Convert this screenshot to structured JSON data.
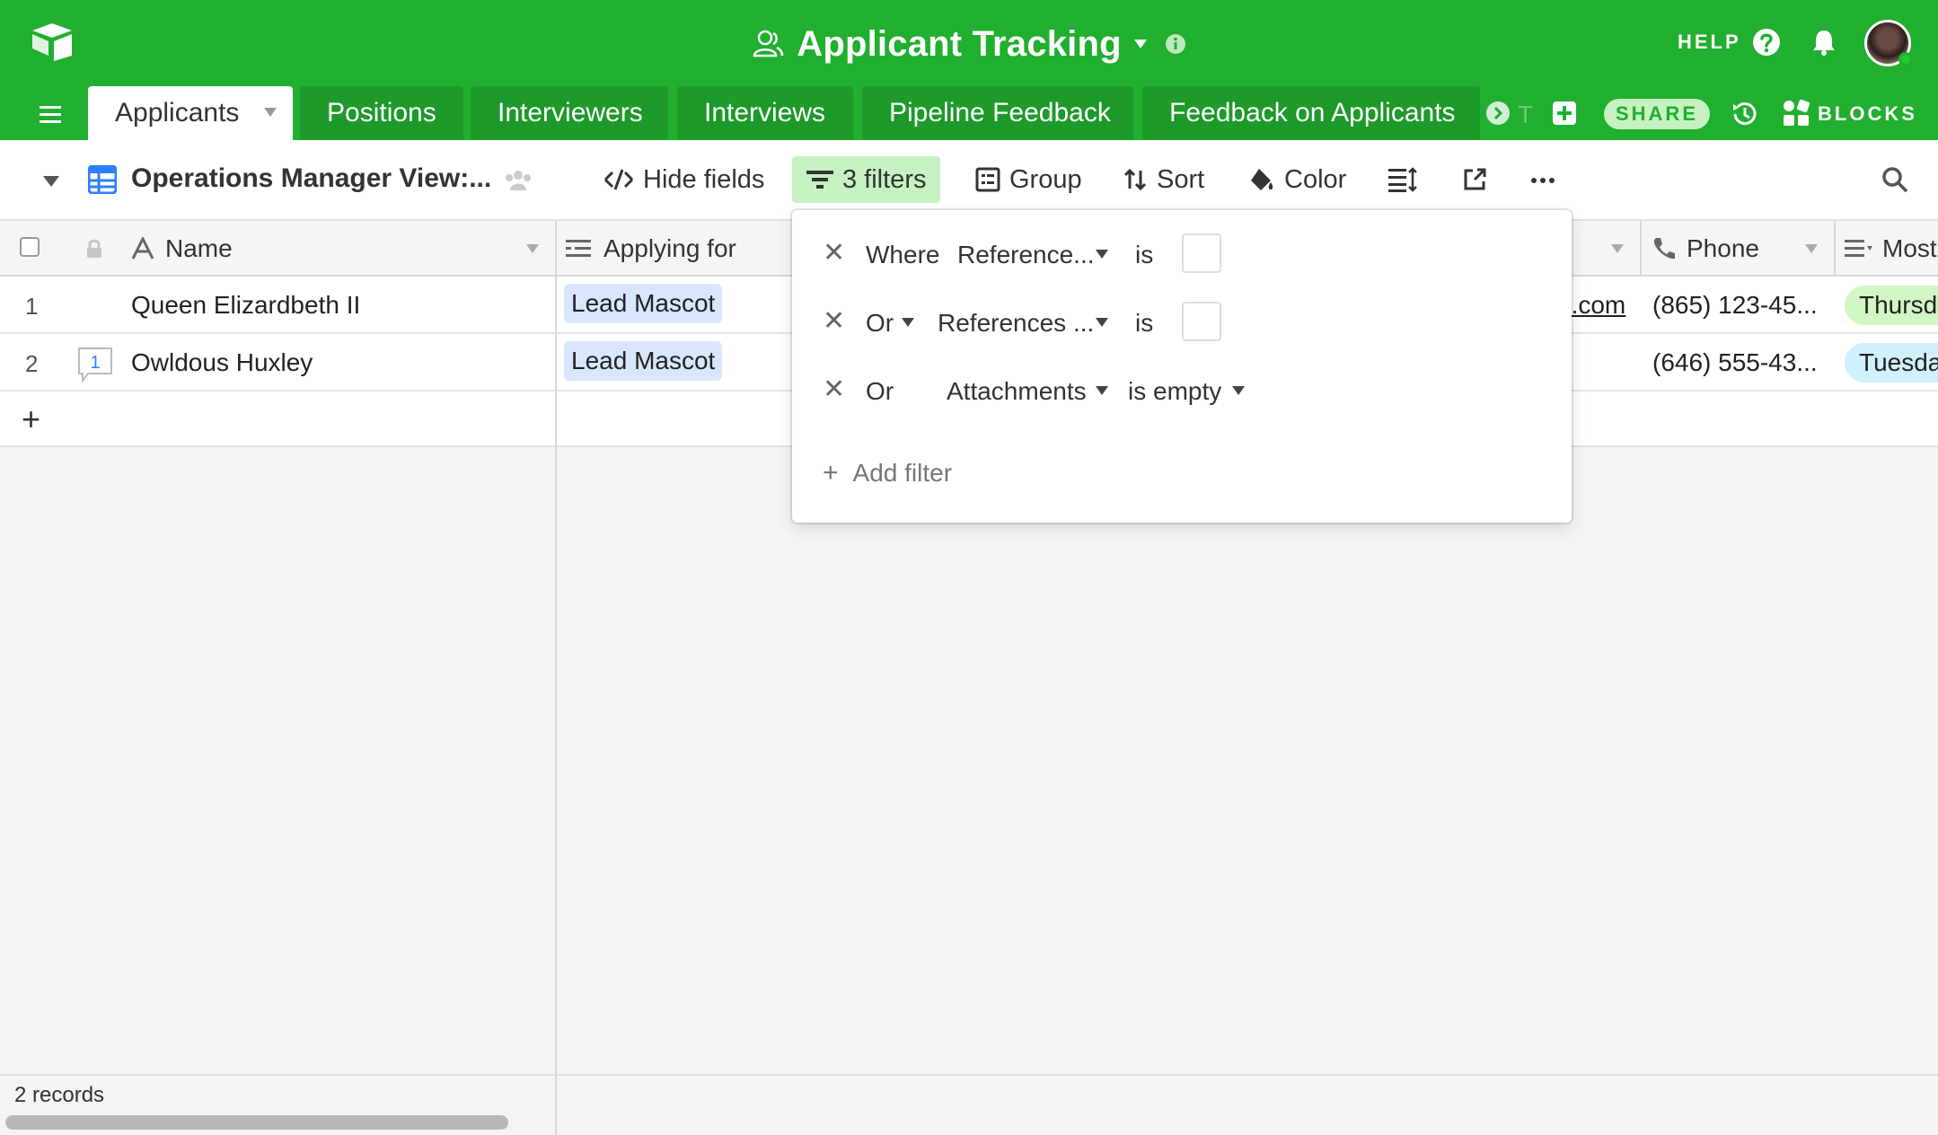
{
  "header": {
    "base_title": "Applicant Tracking",
    "help_label": "HELP"
  },
  "tabs": [
    {
      "label": "Applicants"
    },
    {
      "label": "Positions"
    },
    {
      "label": "Interviewers"
    },
    {
      "label": "Interviews"
    },
    {
      "label": "Pipeline Feedback"
    },
    {
      "label": "Feedback on Applicants"
    }
  ],
  "tab_overflow_label": "T",
  "share_label": "SHARE",
  "blocks_label": "BLOCKS",
  "view": {
    "name": "Operations Manager View:...",
    "toolbar": {
      "hide_fields": "Hide fields",
      "filters": "3 filters",
      "group": "Group",
      "sort": "Sort",
      "color": "Color"
    }
  },
  "columns": {
    "name": "Name",
    "applying_for": "Applying for",
    "phone": "Phone",
    "most": "Most"
  },
  "rows": [
    {
      "num": "1",
      "name": "Queen Elizardbeth II",
      "applying_for": "Lead Mascot",
      "email_tail": "e.com",
      "phone": "(865) 123-45...",
      "day": "Thursda"
    },
    {
      "num": "2",
      "name": "Owldous Huxley",
      "applying_for": "Lead Mascot",
      "email_tail": "",
      "phone": "(646) 555-43...",
      "day": "Tuesday",
      "comments": "1"
    }
  ],
  "filters": [
    {
      "conjunction": "Where",
      "field": "Reference...",
      "operator": "is"
    },
    {
      "conjunction": "Or",
      "field": "References ...",
      "operator": "is"
    },
    {
      "conjunction": "Or",
      "field": "Attachments",
      "operator": "is empty"
    }
  ],
  "add_filter_label": "Add filter",
  "footer": {
    "records": "2 records"
  },
  "colors": {
    "brand_green": "#20af2e",
    "tab_inactive": "#1d9a2a",
    "filter_active_bg": "#c6f2c2",
    "link_pill": "#d9e6fd"
  }
}
